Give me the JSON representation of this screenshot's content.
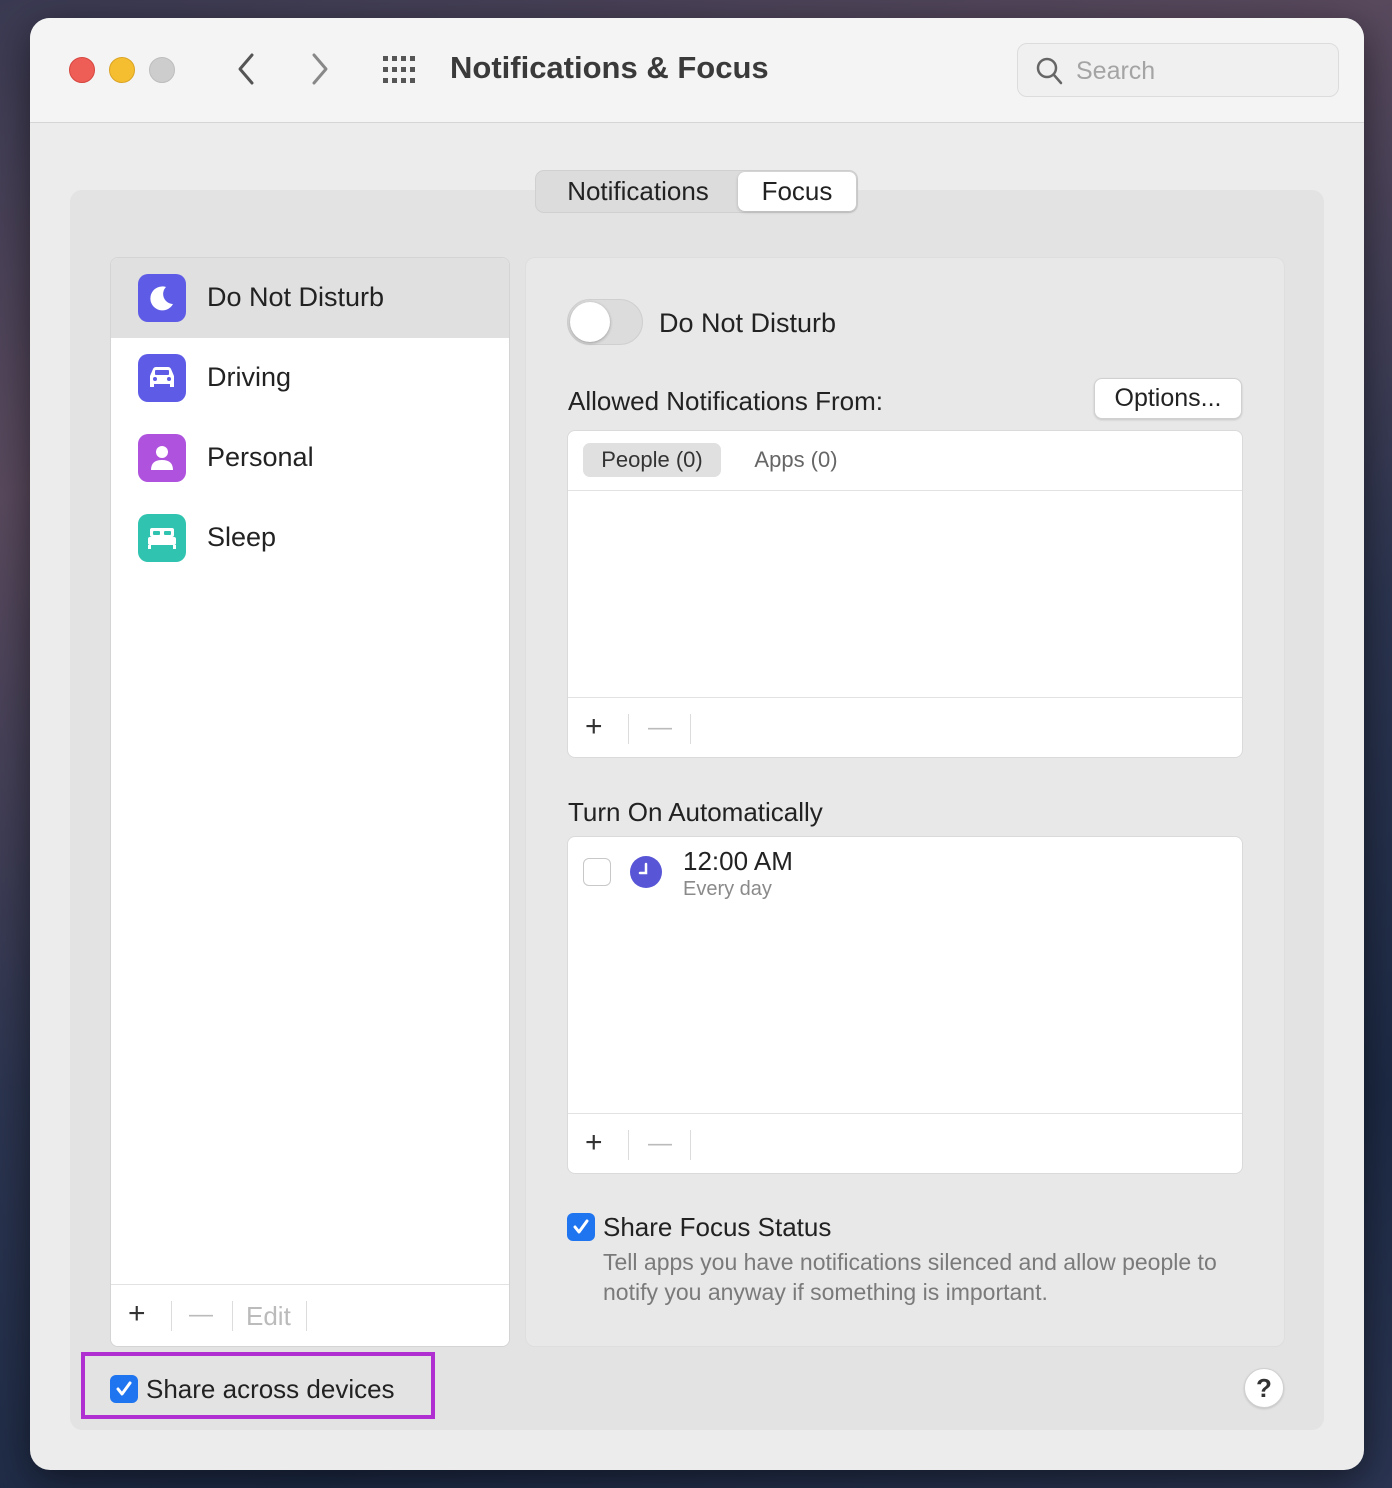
{
  "window": {
    "title": "Notifications & Focus",
    "search_placeholder": "Search"
  },
  "tabs": [
    {
      "label": "Notifications",
      "selected": false
    },
    {
      "label": "Focus",
      "selected": true
    }
  ],
  "sidebar": {
    "items": [
      {
        "label": "Do Not Disturb",
        "icon": "moon-icon",
        "color": "#5e5ce6",
        "selected": true
      },
      {
        "label": "Driving",
        "icon": "car-icon",
        "color": "#5e5ce6",
        "selected": false
      },
      {
        "label": "Personal",
        "icon": "person-icon",
        "color": "#af52de",
        "selected": false
      },
      {
        "label": "Sleep",
        "icon": "bed-icon",
        "color": "#30c3b0",
        "selected": false
      }
    ],
    "footer": {
      "add": "+",
      "remove": "—",
      "edit": "Edit"
    }
  },
  "detail": {
    "toggle_label": "Do Not Disturb",
    "toggle_on": false,
    "allowed_label": "Allowed Notifications From:",
    "options_button": "Options...",
    "allowed_tabs": [
      {
        "label": "People (0)",
        "selected": true
      },
      {
        "label": "Apps (0)",
        "selected": false
      }
    ],
    "auto_label": "Turn On Automatically",
    "schedule": {
      "time": "12:00 AM",
      "repeat": "Every day",
      "enabled": false
    },
    "share_focus": {
      "checked": true,
      "label": "Share Focus Status",
      "description": "Tell apps you have notifications silenced and allow people to notify you anyway if something is important."
    }
  },
  "bottom": {
    "share_devices_label": "Share across devices",
    "share_devices_checked": true,
    "help": "?"
  },
  "colors": {
    "accent": "#1f74f0",
    "highlight_border": "#b02fd0"
  }
}
